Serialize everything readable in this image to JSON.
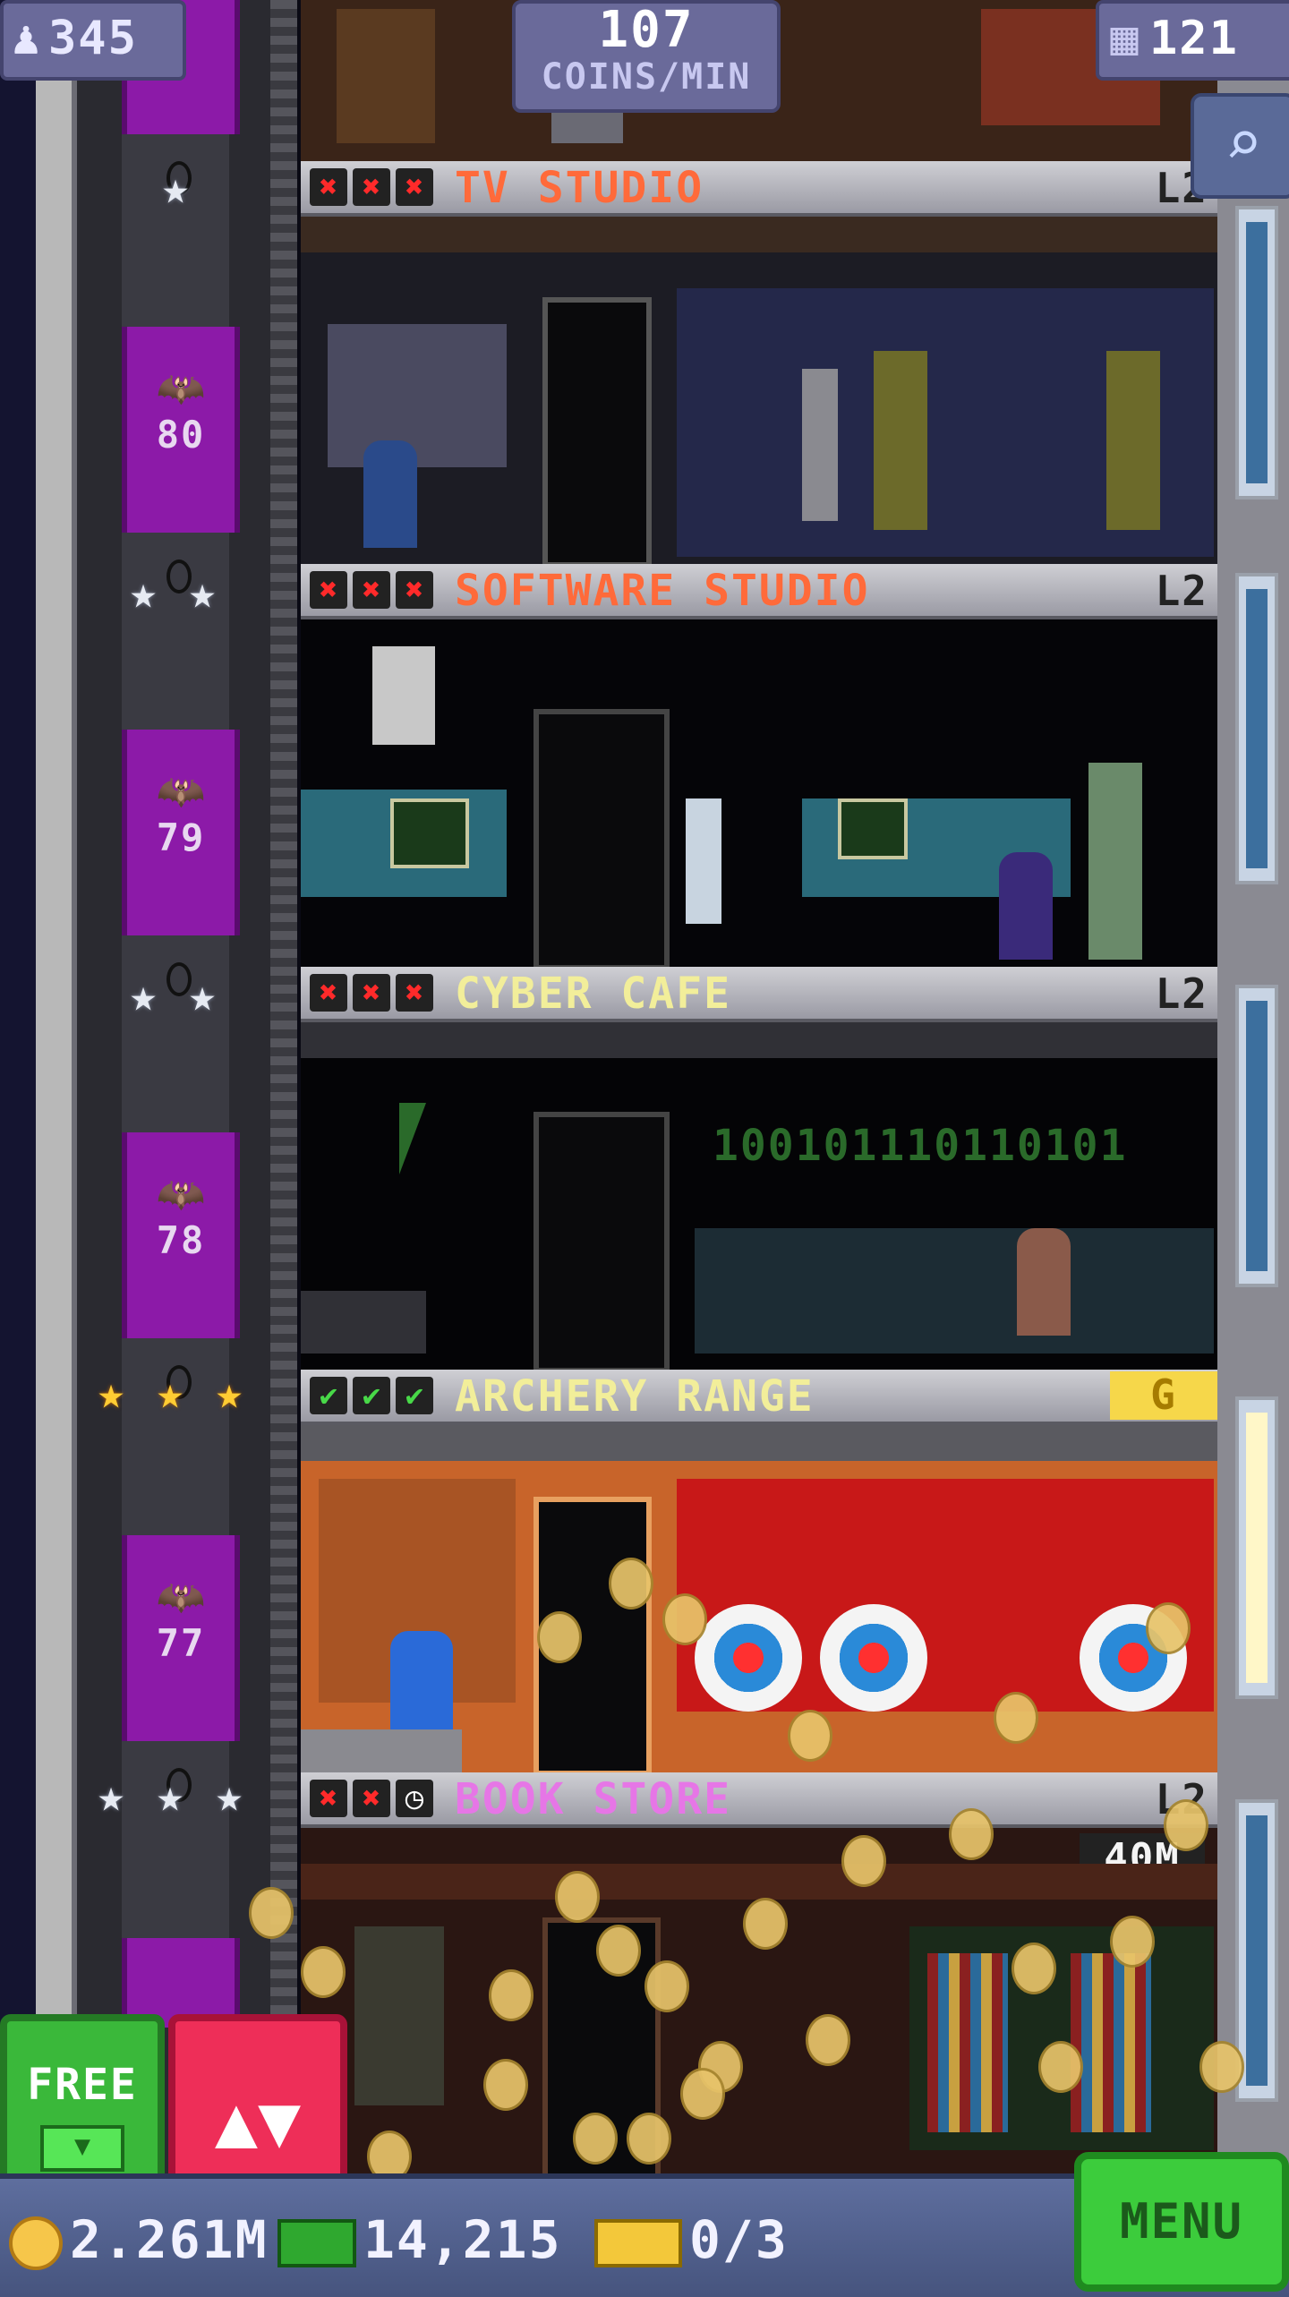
{
  "hud": {
    "population": "345",
    "population_icon": "person-icon",
    "coins_per_min_value": "107",
    "coins_per_min_label": "COINS/MIN",
    "tower_bux_top": "121",
    "tower_bux_icon": "building-icon",
    "zoom_icon": "magnifier-icon"
  },
  "floors": [
    {
      "name": "TV STUDIO",
      "name_color": "#ff6a3a",
      "level": "L2",
      "marks": [
        "x",
        "x",
        "x"
      ],
      "stars": "silver1",
      "elevator_number": "80"
    },
    {
      "name": "SOFTWARE STUDIO",
      "name_color": "#ff6a3a",
      "level": "L2",
      "marks": [
        "x",
        "x",
        "x"
      ],
      "stars": "silver2",
      "elevator_number": "79"
    },
    {
      "name": "CYBER CAFE",
      "name_color": "#f2ee9a",
      "level": "L2",
      "marks": [
        "x",
        "x",
        "x"
      ],
      "stars": "silver2",
      "elevator_number": "78"
    },
    {
      "name": "ARCHERY RANGE",
      "name_color": "#f2ee9a",
      "level": "G",
      "marks": [
        "check",
        "check",
        "check"
      ],
      "stars": "gold3",
      "elevator_number": "77"
    },
    {
      "name": "BOOK STORE",
      "name_color": "#e676e6",
      "level": "L2",
      "marks": [
        "x",
        "x",
        "clock"
      ],
      "stars": "silver3",
      "timer": "40M"
    }
  ],
  "cyber_cafe_binary": "100101110110101",
  "buttons": {
    "free_label": "FREE",
    "elevator_label": "▲▼",
    "menu_label": "MENU"
  },
  "resources": {
    "coins": "2.261M",
    "bux": "14,215",
    "vip": "0/3"
  },
  "colors": {
    "hud_panel": "#6a6a9a",
    "free_green": "#3ab83a",
    "elevator_red": "#ee2e58",
    "menu_green": "#3ccc3c",
    "elevator_purple": "#8c1aa8"
  }
}
